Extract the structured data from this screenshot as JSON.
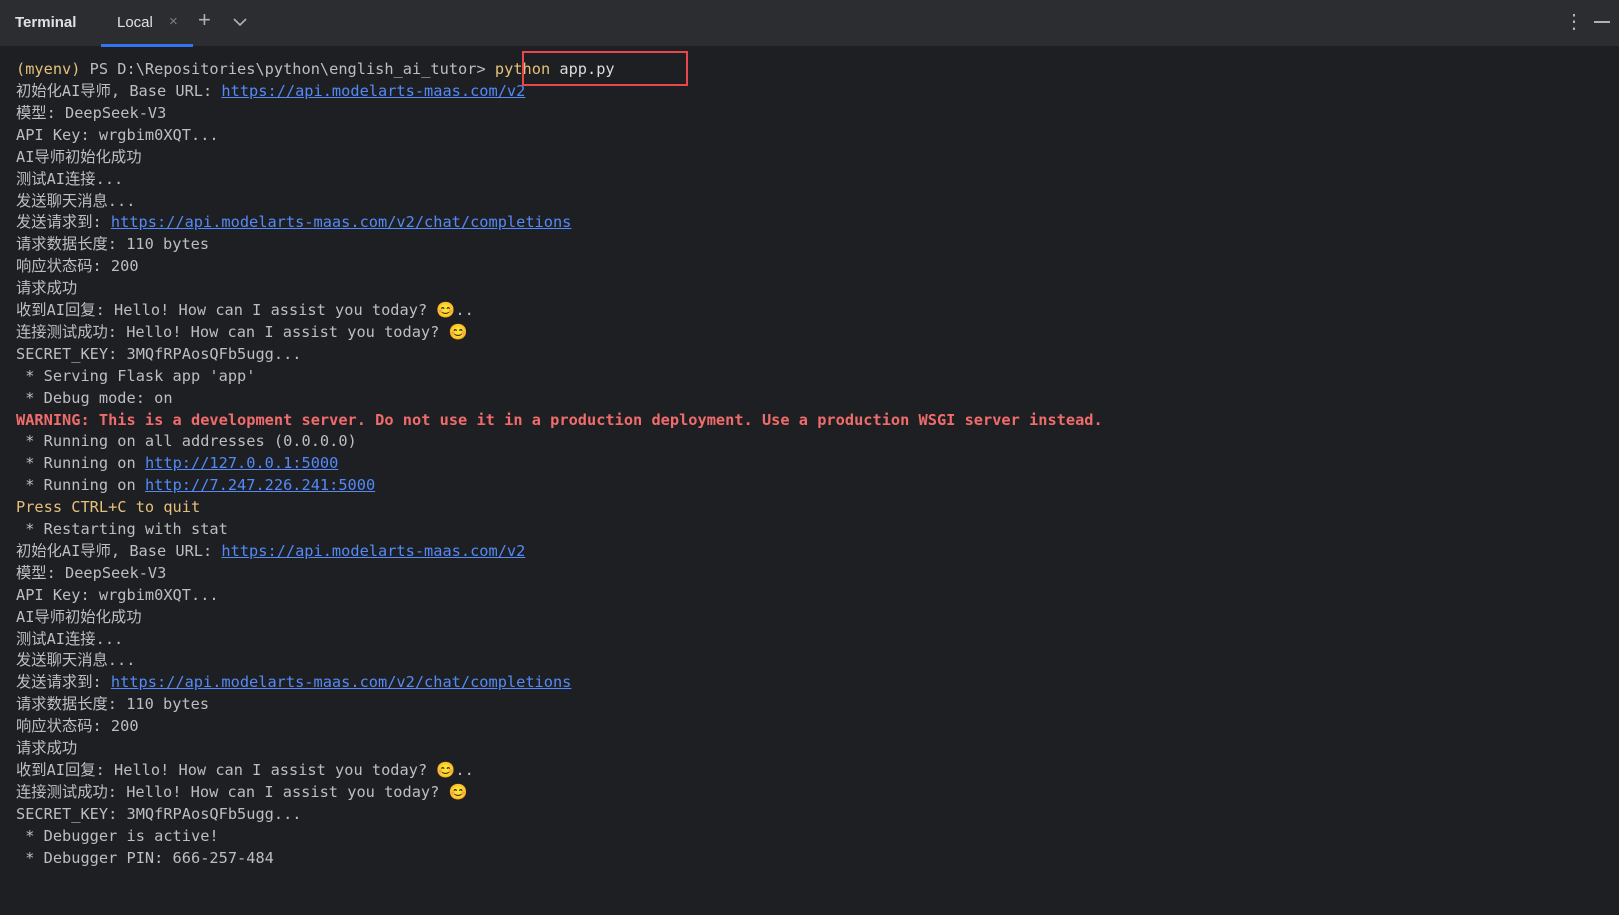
{
  "header": {
    "panel_title": "Terminal",
    "tab_label": "Local",
    "close_glyph": "×",
    "add_glyph": "+",
    "dropdown_glyph": "⌄",
    "more_glyph": "⋮",
    "icons": [
      "close-icon",
      "plus-icon",
      "chevron-down-icon",
      "more-vertical-icon",
      "minimize-icon"
    ]
  },
  "prompt": {
    "env": "(myenv)",
    "path": " PS D:\\Repositories\\python\\english_ai_tutor> ",
    "command": "python",
    "args": " app.py"
  },
  "output": [
    {
      "pre": "初始化AI导师, Base URL: ",
      "link": "https://api.modelarts-maas.com/v2"
    },
    {
      "text": "模型: DeepSeek-V3"
    },
    {
      "text": "API Key: wrgbim0XQT..."
    },
    {
      "text": "AI导师初始化成功"
    },
    {
      "text": "测试AI连接..."
    },
    {
      "text": "发送聊天消息..."
    },
    {
      "pre": "发送请求到: ",
      "link": "https://api.modelarts-maas.com/v2/chat/completions"
    },
    {
      "text": "请求数据长度: 110 bytes"
    },
    {
      "text": "响应状态码: 200"
    },
    {
      "text": "请求成功"
    },
    {
      "text": "收到AI回复: Hello! How can I assist you today? 😊.."
    },
    {
      "text": "连接测试成功: Hello! How can I assist you today? 😊"
    },
    {
      "text": "SECRET_KEY: 3MQfRPAosQFb5ugg..."
    },
    {
      "text": " * Serving Flask app 'app'"
    },
    {
      "text": " * Debug mode: on"
    },
    {
      "warn": "WARNING: This is a development server. Do not use it in a production deployment. Use a production WSGI server instead."
    },
    {
      "text": " * Running on all addresses (0.0.0.0)"
    },
    {
      "pre": " * Running on ",
      "link": "http://127.0.0.1:5000"
    },
    {
      "pre": " * Running on ",
      "link": "http://7.247.226.241:5000"
    },
    {
      "yellow": "Press CTRL+C to quit"
    },
    {
      "text": " * Restarting with stat"
    },
    {
      "pre": "初始化AI导师, Base URL: ",
      "link": "https://api.modelarts-maas.com/v2"
    },
    {
      "text": "模型: DeepSeek-V3"
    },
    {
      "text": "API Key: wrgbim0XQT..."
    },
    {
      "text": "AI导师初始化成功"
    },
    {
      "text": "测试AI连接..."
    },
    {
      "text": "发送聊天消息..."
    },
    {
      "pre": "发送请求到: ",
      "link": "https://api.modelarts-maas.com/v2/chat/completions"
    },
    {
      "text": "请求数据长度: 110 bytes"
    },
    {
      "text": "响应状态码: 200"
    },
    {
      "text": "请求成功"
    },
    {
      "text": "收到AI回复: Hello! How can I assist you today? 😊.."
    },
    {
      "text": "连接测试成功: Hello! How can I assist you today? 😊"
    },
    {
      "text": "SECRET_KEY: 3MQfRPAosQFb5ugg..."
    },
    {
      "text": " * Debugger is active!"
    },
    {
      "text": " * Debugger PIN: 666-257-484"
    }
  ]
}
